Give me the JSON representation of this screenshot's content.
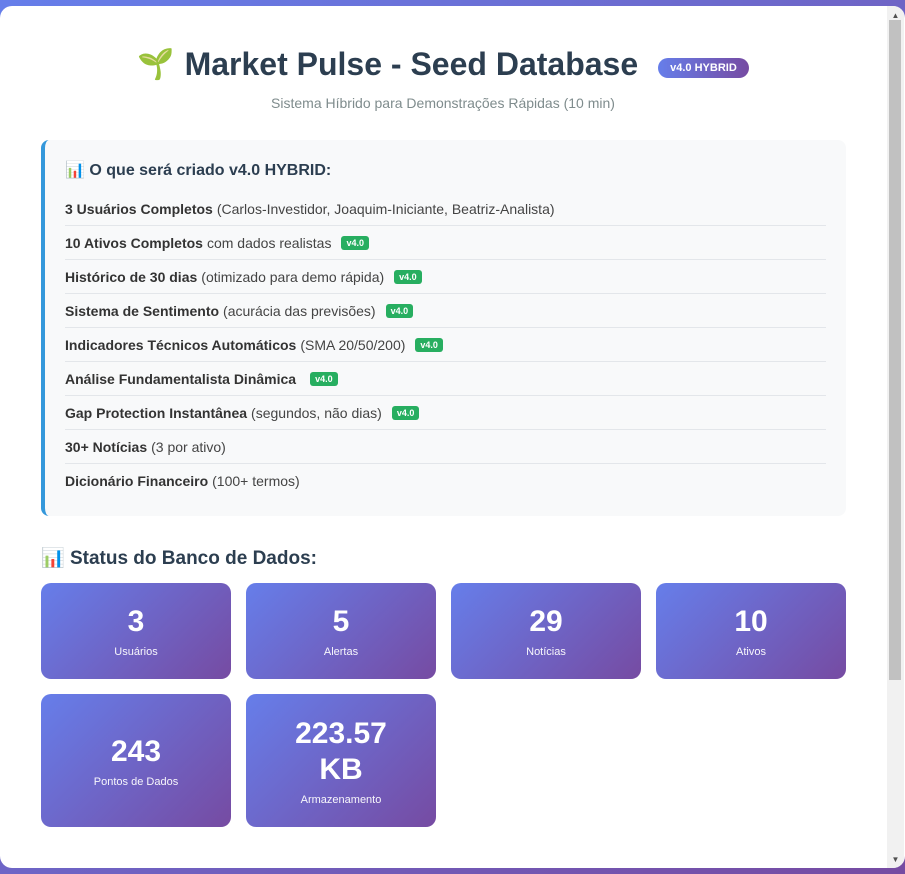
{
  "header": {
    "icon": "🌱",
    "title": "Market Pulse - Seed Database",
    "badge": "v4.0 HYBRID",
    "subtitle": "Sistema Híbrido para Demonstrações Rápidas (10 min)"
  },
  "info": {
    "icon": "📊",
    "title": "O que será criado v4.0 HYBRID:",
    "items": [
      {
        "bold": "3 Usuários Completos",
        "text": "(Carlos-Investidor, Joaquim-Iniciante, Beatriz-Analista)",
        "badge": ""
      },
      {
        "bold": "10 Ativos Completos",
        "text": "com dados realistas",
        "badge": "v4.0"
      },
      {
        "bold": "Histórico de 30 dias",
        "text": "(otimizado para demo rápida)",
        "badge": "v4.0"
      },
      {
        "bold": "Sistema de Sentimento",
        "text": "(acurácia das previsões)",
        "badge": "v4.0"
      },
      {
        "bold": "Indicadores Técnicos Automáticos",
        "text": "(SMA 20/50/200)",
        "badge": "v4.0"
      },
      {
        "bold": "Análise Fundamentalista Dinâmica",
        "text": "",
        "badge": "v4.0"
      },
      {
        "bold": "Gap Protection Instantânea",
        "text": "(segundos, não dias)",
        "badge": "v4.0"
      },
      {
        "bold": "30+ Notícias",
        "text": "(3 por ativo)",
        "badge": ""
      },
      {
        "bold": "Dicionário Financeiro",
        "text": "(100+ termos)",
        "badge": ""
      }
    ]
  },
  "status": {
    "icon": "📊",
    "title": "Status do Banco de Dados:",
    "stats": [
      {
        "value": "3",
        "label": "Usuários"
      },
      {
        "value": "5",
        "label": "Alertas"
      },
      {
        "value": "29",
        "label": "Notícias"
      },
      {
        "value": "10",
        "label": "Ativos"
      },
      {
        "value": "243",
        "label": "Pontos de Dados"
      },
      {
        "value": "223.57 KB",
        "label": "Armazenamento"
      }
    ]
  },
  "colors": {
    "accent_start": "#667eea",
    "accent_end": "#764ba2",
    "badge_green": "#27ae60",
    "info_border": "#3498db"
  }
}
